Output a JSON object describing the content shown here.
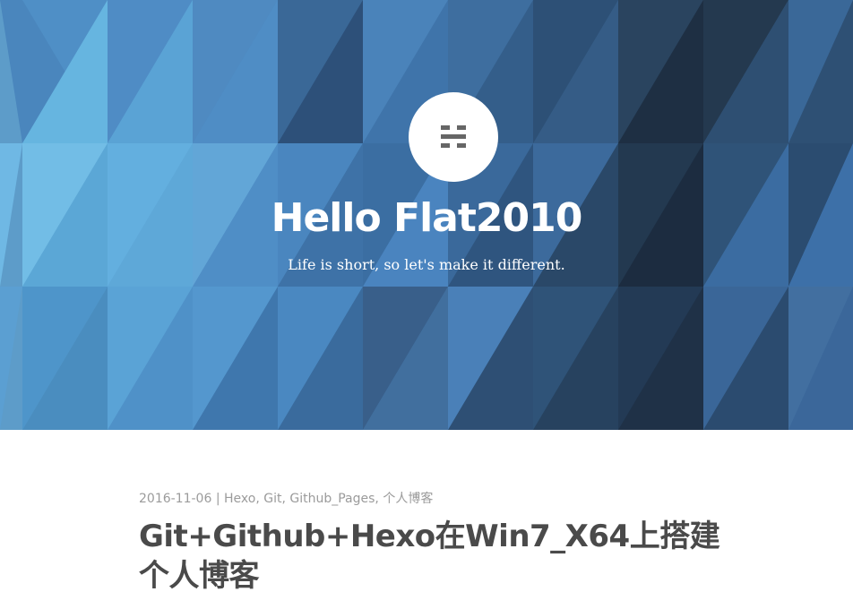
{
  "header": {
    "logo_icon": "hexo-logo-icon",
    "title": "Hello Flat2010",
    "subtitle": "Life is short, so let's make it different."
  },
  "post": {
    "date": "2016-11-06",
    "separator": " | ",
    "tags": [
      "Hexo",
      "Git",
      "Github_Pages",
      "个人博客"
    ],
    "title": "Git+Github+Hexo在Win7_X64上搭建个人博客"
  },
  "colors": {
    "hero_light": "#63aedb",
    "hero_mid": "#4a7eb3",
    "hero_dark": "#1f3248",
    "meta_text": "#9b9b9b",
    "title_text": "#4a4a4a"
  }
}
